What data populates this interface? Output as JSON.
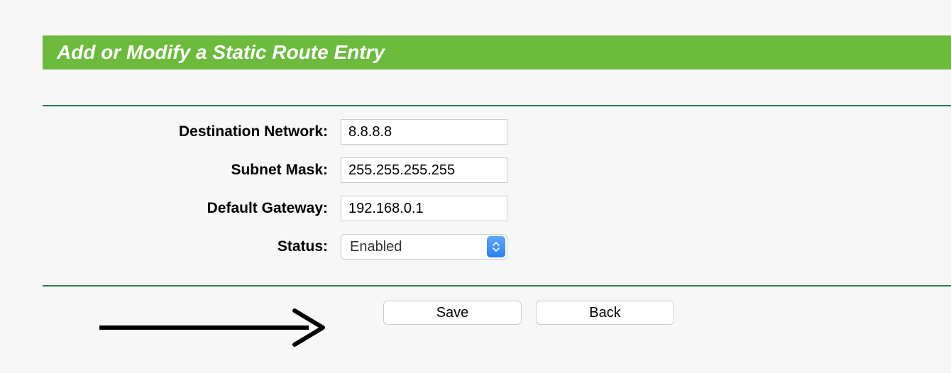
{
  "header": {
    "title": "Add or Modify a Static Route Entry"
  },
  "form": {
    "destination_network": {
      "label": "Destination Network:",
      "value": "8.8.8.8"
    },
    "subnet_mask": {
      "label": "Subnet Mask:",
      "value": "255.255.255.255"
    },
    "default_gateway": {
      "label": "Default Gateway:",
      "value": "192.168.0.1"
    },
    "status": {
      "label": "Status:",
      "selected": "Enabled"
    }
  },
  "buttons": {
    "save": "Save",
    "back": "Back"
  }
}
